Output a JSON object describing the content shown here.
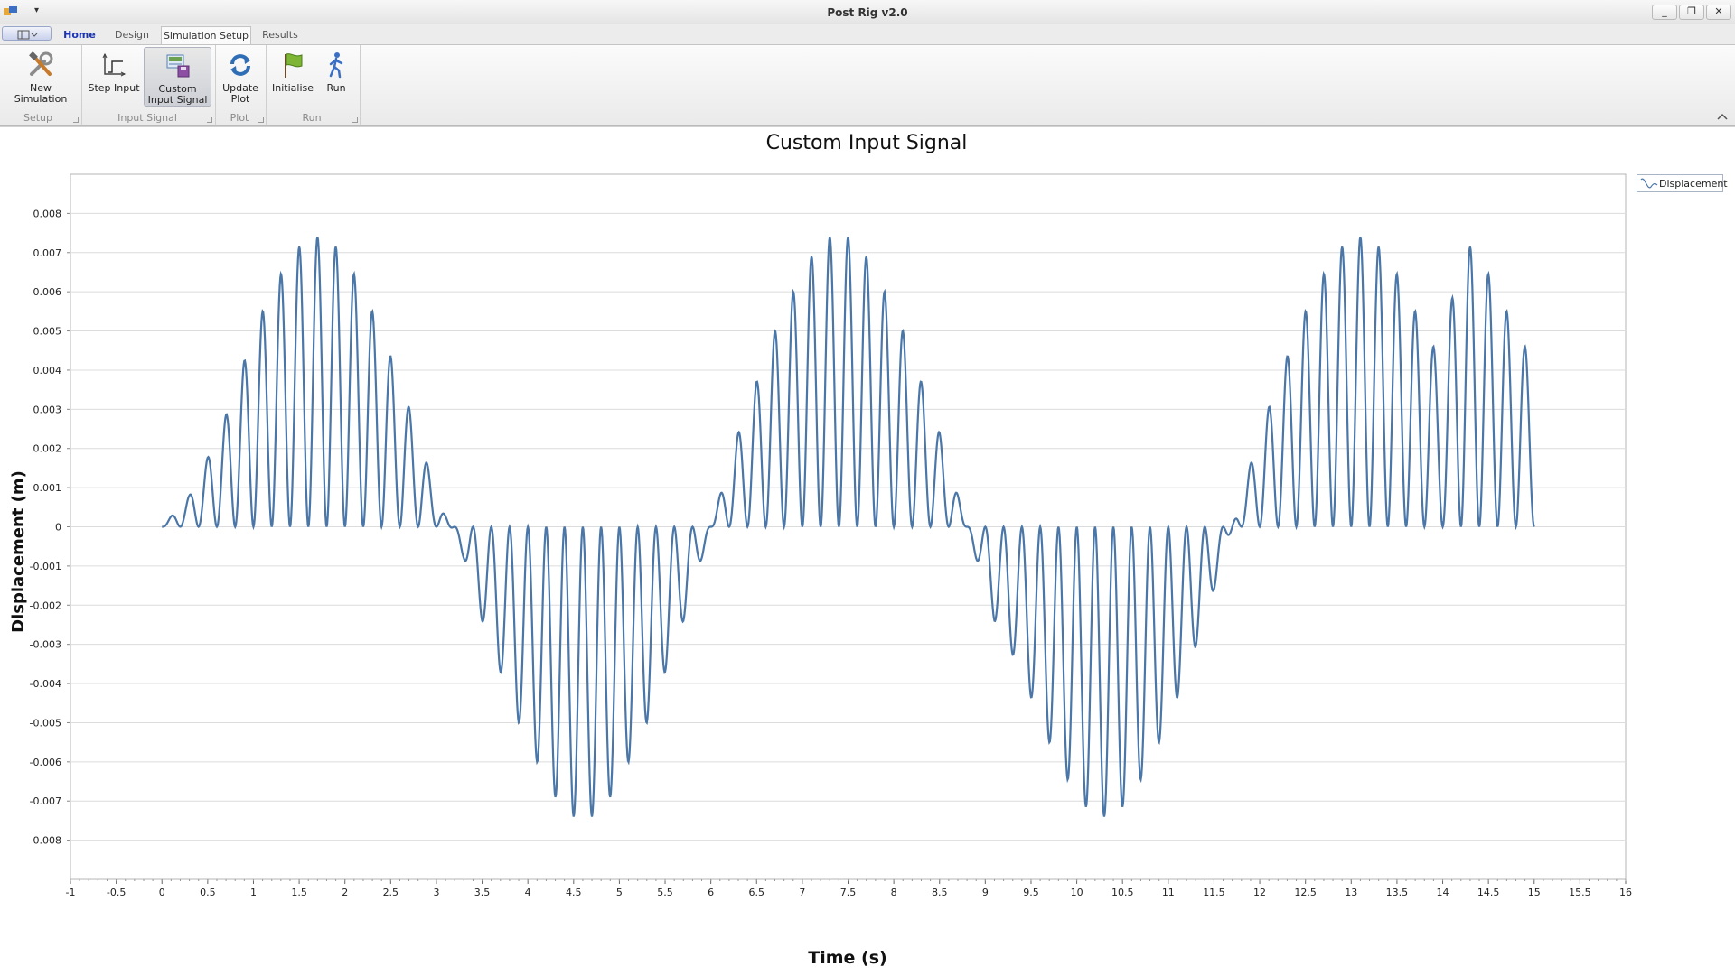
{
  "window": {
    "title": "Post Rig v2.0",
    "minimize": "_",
    "restore": "❐",
    "close": "✕"
  },
  "ribbon": {
    "tabs": [
      {
        "label": "Home"
      },
      {
        "label": "Design"
      },
      {
        "label": "Simulation Setup"
      },
      {
        "label": "Results"
      }
    ],
    "active_tab": "Simulation Setup",
    "groups": [
      {
        "label": "Setup",
        "buttons": [
          {
            "label": "New Simulation",
            "icon": "tools-icon"
          }
        ]
      },
      {
        "label": "Input Signal",
        "buttons": [
          {
            "label": "Step Input",
            "icon": "step-input-icon"
          },
          {
            "label": "Custom Input Signal",
            "icon": "custom-signal-icon",
            "pressed": true
          }
        ]
      },
      {
        "label": "Plot",
        "buttons": [
          {
            "label": "Update Plot",
            "icon": "refresh-icon"
          }
        ]
      },
      {
        "label": "Run",
        "buttons": [
          {
            "label": "Initialise",
            "icon": "flag-icon"
          },
          {
            "label": "Run",
            "icon": "run-icon"
          }
        ]
      }
    ]
  },
  "chart_data": {
    "type": "line",
    "title": "Custom Input Signal",
    "xlabel": "Time (s)",
    "ylabel": "Displacement (m)",
    "xlim": [
      -1,
      16
    ],
    "ylim": [
      -0.009,
      0.009
    ],
    "x_ticks": [
      "-1",
      "-0.5",
      "0",
      "0.5",
      "1",
      "1.5",
      "2",
      "2.5",
      "3",
      "3.5",
      "4",
      "4.5",
      "5",
      "5.5",
      "6",
      "6.5",
      "7",
      "7.5",
      "8",
      "8.5",
      "9",
      "9.5",
      "10",
      "10.5",
      "11",
      "11.5",
      "12",
      "12.5",
      "13",
      "13.5",
      "14",
      "14.5",
      "15",
      "15.5",
      "16"
    ],
    "y_ticks": [
      "0.008",
      "0.007",
      "0.006",
      "0.005",
      "0.004",
      "0.003",
      "0.002",
      "0.001",
      "0",
      "-0.001",
      "-0.002",
      "-0.003",
      "-0.004",
      "-0.005",
      "-0.006",
      "-0.007",
      "-0.008"
    ],
    "grid": "horizontal",
    "legend": "top-right",
    "line_color": "#4a76a8",
    "series": [
      {
        "name": "Displacement",
        "x": [
          0,
          0.3,
          0.63,
          0.83,
          1.0,
          1.2,
          1.4,
          1.6,
          1.8,
          2.0,
          2.2,
          2.4,
          2.6,
          2.8,
          3.0,
          3.3,
          3.5,
          3.7,
          3.9,
          4.1,
          4.3,
          4.5,
          4.7,
          4.9,
          5.1,
          5.3,
          5.5,
          5.7,
          5.9,
          6.1,
          6.3,
          6.5,
          6.7,
          6.9,
          7.1,
          7.3,
          7.5,
          7.7,
          7.9,
          8.1,
          8.3,
          8.5,
          8.7,
          8.9,
          9.1,
          9.4,
          9.6,
          9.8,
          10.0,
          10.2,
          10.4,
          10.6,
          10.8,
          11.0,
          11.2,
          11.4,
          11.6,
          11.8,
          12.0,
          12.2,
          12.4,
          12.6,
          12.8,
          13.0,
          13.2,
          13.4,
          13.6,
          13.8,
          14.0,
          14.2,
          14.4,
          14.6,
          14.8,
          15.0
        ],
        "y": [
          0,
          0.0008,
          0.0024,
          0.0037,
          0.005,
          0.006,
          0.0069,
          0.0074,
          0.0074,
          0.0069,
          0.006,
          0.005,
          0.0037,
          0.0024,
          0.0008,
          -0.0008,
          -0.0024,
          -0.0037,
          -0.005,
          -0.006,
          -0.0069,
          -0.0074,
          -0.0074,
          -0.0069,
          -0.006,
          -0.005,
          -0.0037,
          -0.0024,
          -0.0008,
          0.0008,
          0.0024,
          0.0037,
          0.005,
          0.006,
          0.0069,
          0.0074,
          0.0074,
          0.0069,
          0.006,
          0.005,
          0.0037,
          0.0024,
          0.0008,
          -0.0008,
          -0.0024,
          -0.0037,
          -0.005,
          -0.006,
          -0.0069,
          -0.0074,
          -0.0074,
          -0.0069,
          -0.006,
          -0.005,
          -0.0037,
          -0.0024,
          -0.0008,
          0.0008,
          0.0024,
          0.0037,
          0.005,
          0.006,
          0.0069,
          0.0074,
          0.0074,
          0.0069,
          0.006,
          0.005,
          0.0042,
          0.0074,
          0.0069,
          0.006,
          0.005,
          0.0042
        ]
      }
    ]
  }
}
